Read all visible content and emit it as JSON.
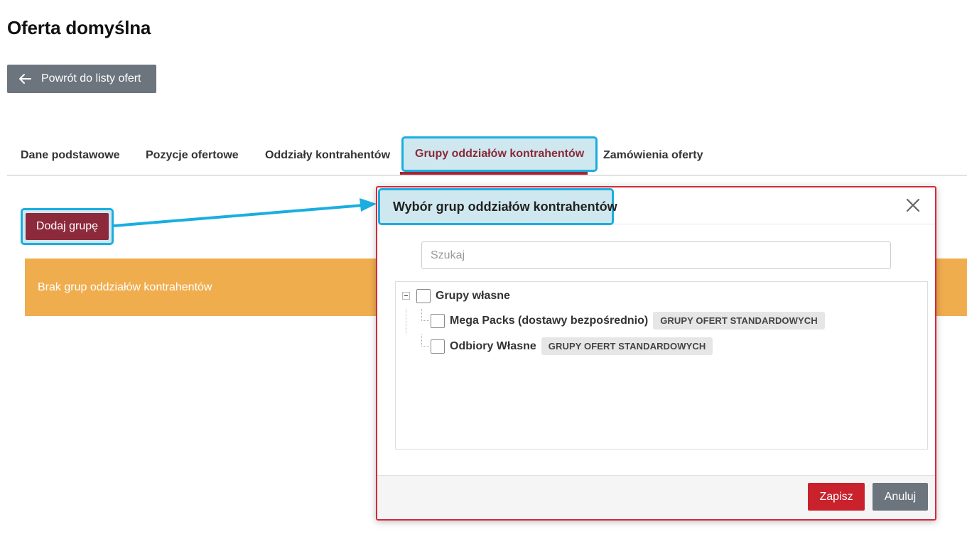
{
  "page": {
    "title": "Oferta domyślna",
    "back_label": "Powrót do listy ofert"
  },
  "tabs": [
    {
      "label": "Dane podstawowe",
      "active": false
    },
    {
      "label": "Pozycje ofertowe",
      "active": false
    },
    {
      "label": "Oddziały kontrahentów",
      "active": false
    },
    {
      "label": "Grupy oddziałów kontrahentów",
      "active": true
    },
    {
      "label": "Zamówienia oferty",
      "active": false
    }
  ],
  "content": {
    "add_group_label": "Dodaj grupę",
    "empty_message": "Brak grup oddziałów kontrahentów"
  },
  "modal": {
    "title": "Wybór grup oddziałów kontrahentów",
    "search_placeholder": "Szukaj",
    "tree": {
      "root_label": "Grupy własne",
      "children": [
        {
          "label": "Mega Packs (dostawy bezpośrednio)",
          "badge": "GRUPY OFERT STANDARDOWYCH"
        },
        {
          "label": "Odbiory Własne",
          "badge": "GRUPY OFERT STANDARDOWYCH"
        }
      ]
    },
    "save_label": "Zapisz",
    "cancel_label": "Anuluj"
  },
  "colors": {
    "accent_red": "#8c2a3c",
    "save_red": "#c9222c",
    "alert_orange": "#f0ad4e",
    "highlight_blue": "#1aaee0",
    "secondary_gray": "#6c757d"
  },
  "icons": [
    "arrow-left-icon",
    "close-icon",
    "collapse-tree-icon"
  ]
}
